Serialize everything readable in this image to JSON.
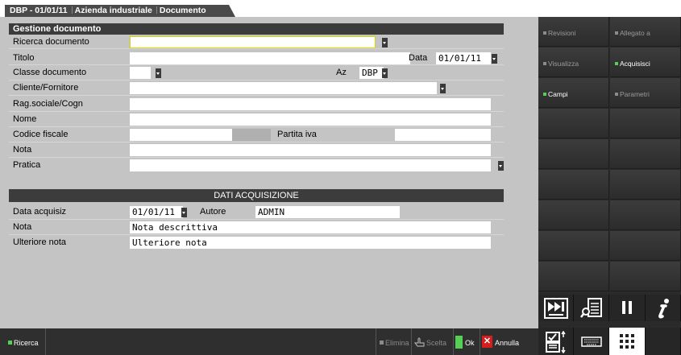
{
  "title_tab": {
    "part1": "DBP - 01/01/11",
    "part2": "Azienda industriale",
    "part3": "Documento"
  },
  "form": {
    "section_title": "Gestione documento",
    "ricerca_documento": {
      "label": "Ricerca documento",
      "value": ""
    },
    "titolo": {
      "label": "Titolo",
      "value": ""
    },
    "data": {
      "label": "Data",
      "value": "01/01/11"
    },
    "classe_documento": {
      "label": "Classe documento",
      "value": ""
    },
    "az": {
      "label": "Az",
      "value": "DBP"
    },
    "cliente_fornitore": {
      "label": "Cliente/Fornitore",
      "value": ""
    },
    "rag_sociale": {
      "label": "Rag.sociale/Cogn",
      "value": ""
    },
    "nome": {
      "label": "Nome",
      "value": ""
    },
    "codice_fiscale": {
      "label": "Codice fiscale",
      "value": ""
    },
    "partita_iva": {
      "label": "Partita iva",
      "value": ""
    },
    "nota": {
      "label": "Nota",
      "value": ""
    },
    "pratica": {
      "label": "Pratica",
      "value": ""
    }
  },
  "acquisizione": {
    "section_title": "DATI ACQUISIZIONE",
    "data_acquisiz": {
      "label": "Data acquisiz",
      "value": "01/01/11"
    },
    "autore": {
      "label": "Autore",
      "value": "ADMIN"
    },
    "nota": {
      "label": "Nota",
      "value": "Nota descrittiva"
    },
    "ulteriore_nota": {
      "label": "Ulteriore nota",
      "value": "Ulteriore nota"
    }
  },
  "side_buttons": {
    "revisioni": "Revisioni",
    "allegato": "Allegato a",
    "visualizza": "Visualizza",
    "acquisisci": "Acquisisci",
    "campi": "Campi",
    "parametri": "Parametri"
  },
  "bottom_bar": {
    "ricerca": "Ricerca",
    "elimina": "Elimina",
    "scelta": "Scelta",
    "ok": "Ok",
    "annulla": "Annulla"
  },
  "colors": {
    "accent_green": "#54d054",
    "header_dark": "#3c3c3c",
    "cancel_red": "#d61e1e",
    "focus_border": "#d8d800"
  },
  "icons": [
    "fast-forward-swap-icon",
    "search-document-icon",
    "pause-icon",
    "info-icon",
    "scan-documents-icon",
    "keyboard-icon",
    "grid-menu-icon"
  ]
}
